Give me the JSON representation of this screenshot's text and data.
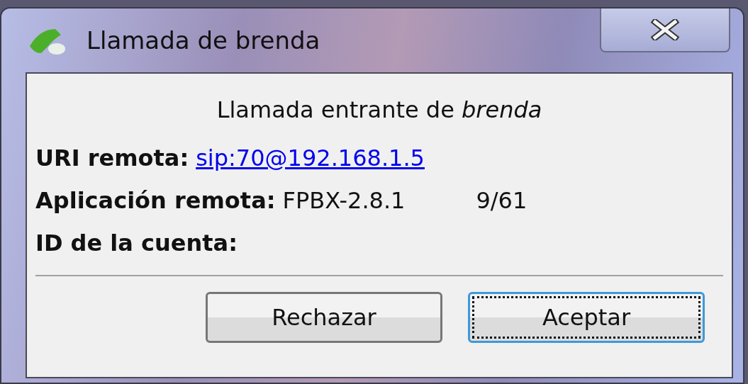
{
  "window": {
    "title": "Llamada de brenda"
  },
  "heading": "Llamada entrante de *brenda*",
  "fields": [
    {
      "label": "URI remota:",
      "value": "sip:70@192.168.1.5",
      "kind": "link"
    },
    {
      "label": "Aplicación remota:",
      "value": "FPBX-2.8.1",
      "extra": "9/61",
      "kind": "text"
    },
    {
      "label": "ID de la cuenta:",
      "kind": "text"
    }
  ],
  "buttons": [
    {
      "label": "Rechazar",
      "focused": false
    },
    {
      "label": "Aceptar",
      "focused": true
    }
  ]
}
